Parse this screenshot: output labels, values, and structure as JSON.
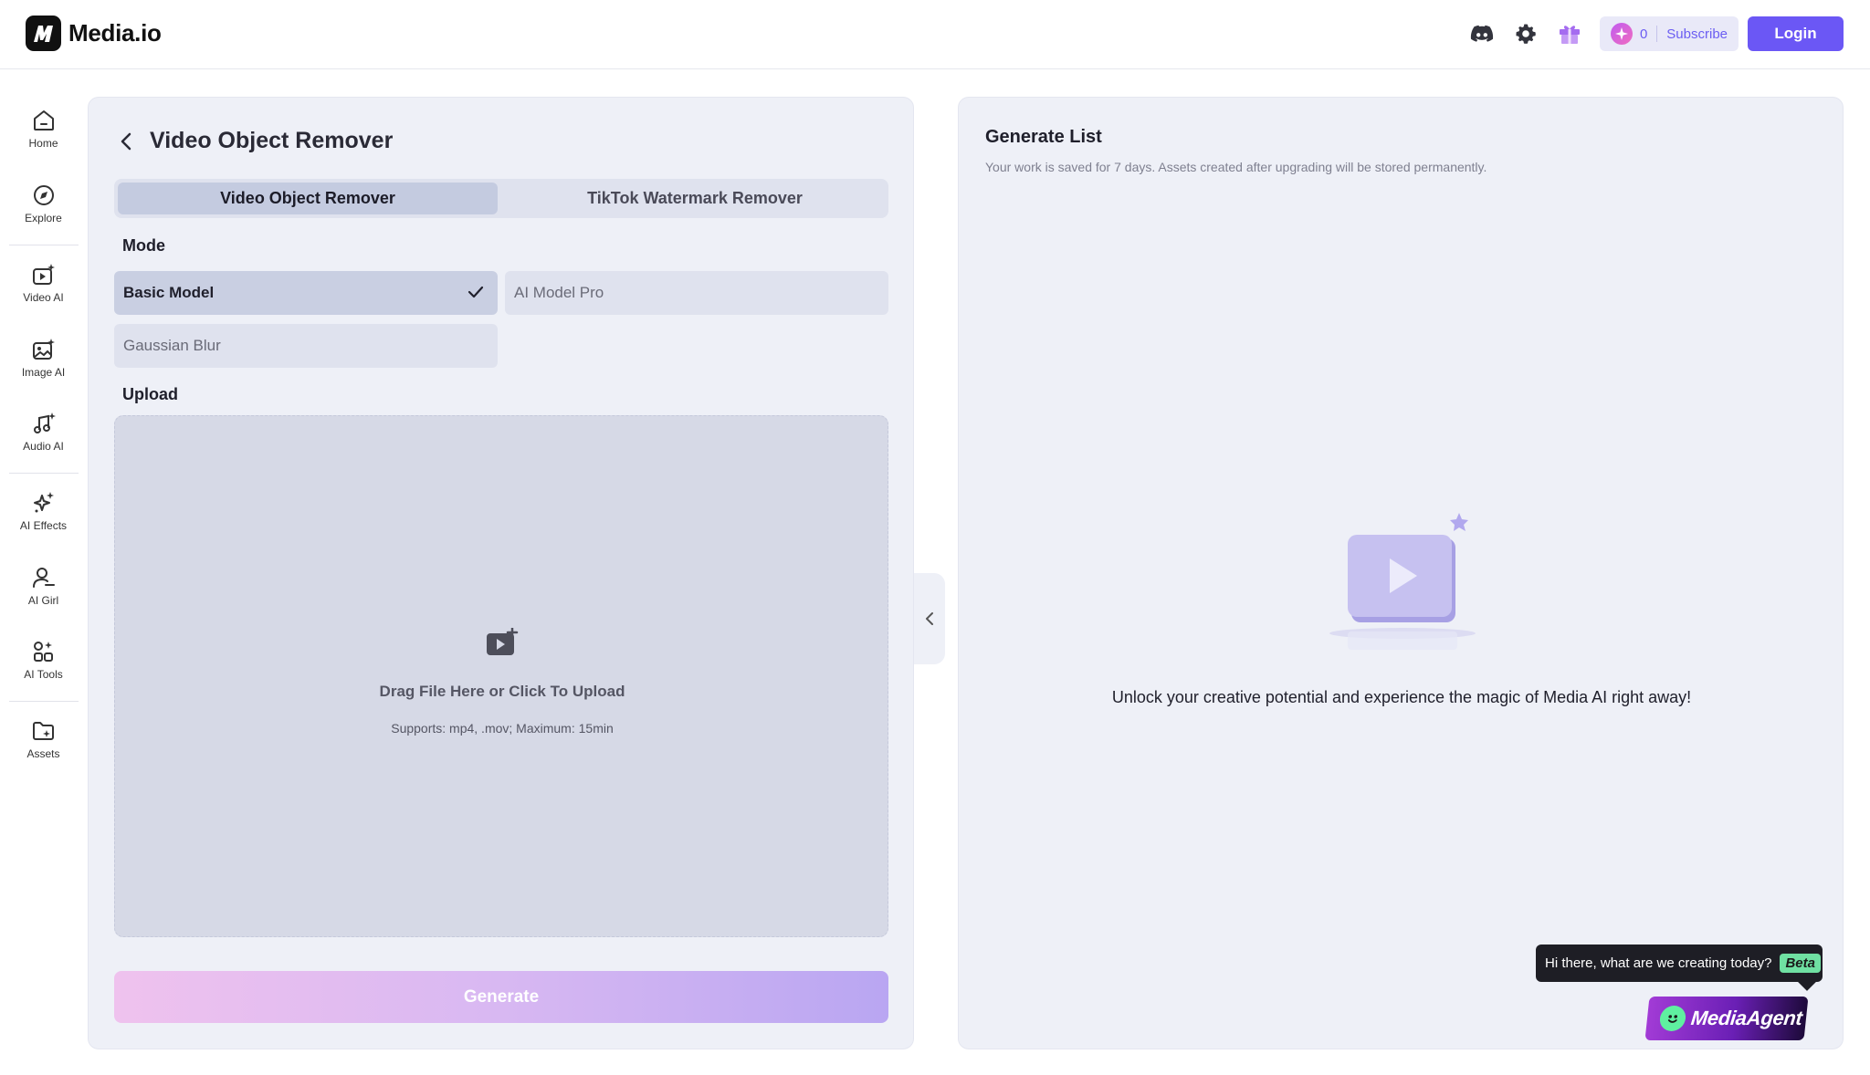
{
  "app": {
    "name": "Media.io"
  },
  "header": {
    "credits": "0",
    "subscribe_label": "Subscribe",
    "login_label": "Login"
  },
  "nav": {
    "items": [
      {
        "label": "Home",
        "icon": "home-icon"
      },
      {
        "label": "Explore",
        "icon": "compass-icon"
      },
      {
        "label": "Video AI",
        "icon": "video-ai-icon"
      },
      {
        "label": "Image AI",
        "icon": "image-ai-icon"
      },
      {
        "label": "Audio AI",
        "icon": "audio-ai-icon"
      },
      {
        "label": "AI Effects",
        "icon": "sparkles-icon"
      },
      {
        "label": "AI Girl",
        "icon": "ai-girl-icon"
      },
      {
        "label": "AI Tools",
        "icon": "tools-grid-icon"
      },
      {
        "label": "Assets",
        "icon": "folder-icon"
      }
    ]
  },
  "tool": {
    "title": "Video Object Remover",
    "tabs": [
      {
        "label": "Video Object Remover",
        "active": true
      },
      {
        "label": "TikTok Watermark Remover",
        "active": false
      }
    ],
    "mode_label": "Mode",
    "modes": [
      {
        "label": "Basic Model",
        "selected": true
      },
      {
        "label": "AI Model Pro",
        "selected": false
      },
      {
        "label": "Gaussian Blur",
        "selected": false
      }
    ],
    "upload_label": "Upload",
    "upload_title": "Drag File Here or Click To Upload",
    "upload_sub": "Supports: mp4, .mov; Maximum: 15min",
    "generate_label": "Generate"
  },
  "generate_list": {
    "title": "Generate List",
    "subtitle": "Your work is saved for 7 days. Assets created after upgrading will be stored permanently.",
    "empty_text": "Unlock your creative potential and experience the magic of Media AI right away!"
  },
  "agent": {
    "greeting": "Hi there, what are we creating today?",
    "badge": "Beta",
    "name": "MediaAgent"
  },
  "colors": {
    "accent": "#6b57f5",
    "panel_bg": "#eef0f7",
    "beta_badge": "#6fe0a2"
  }
}
